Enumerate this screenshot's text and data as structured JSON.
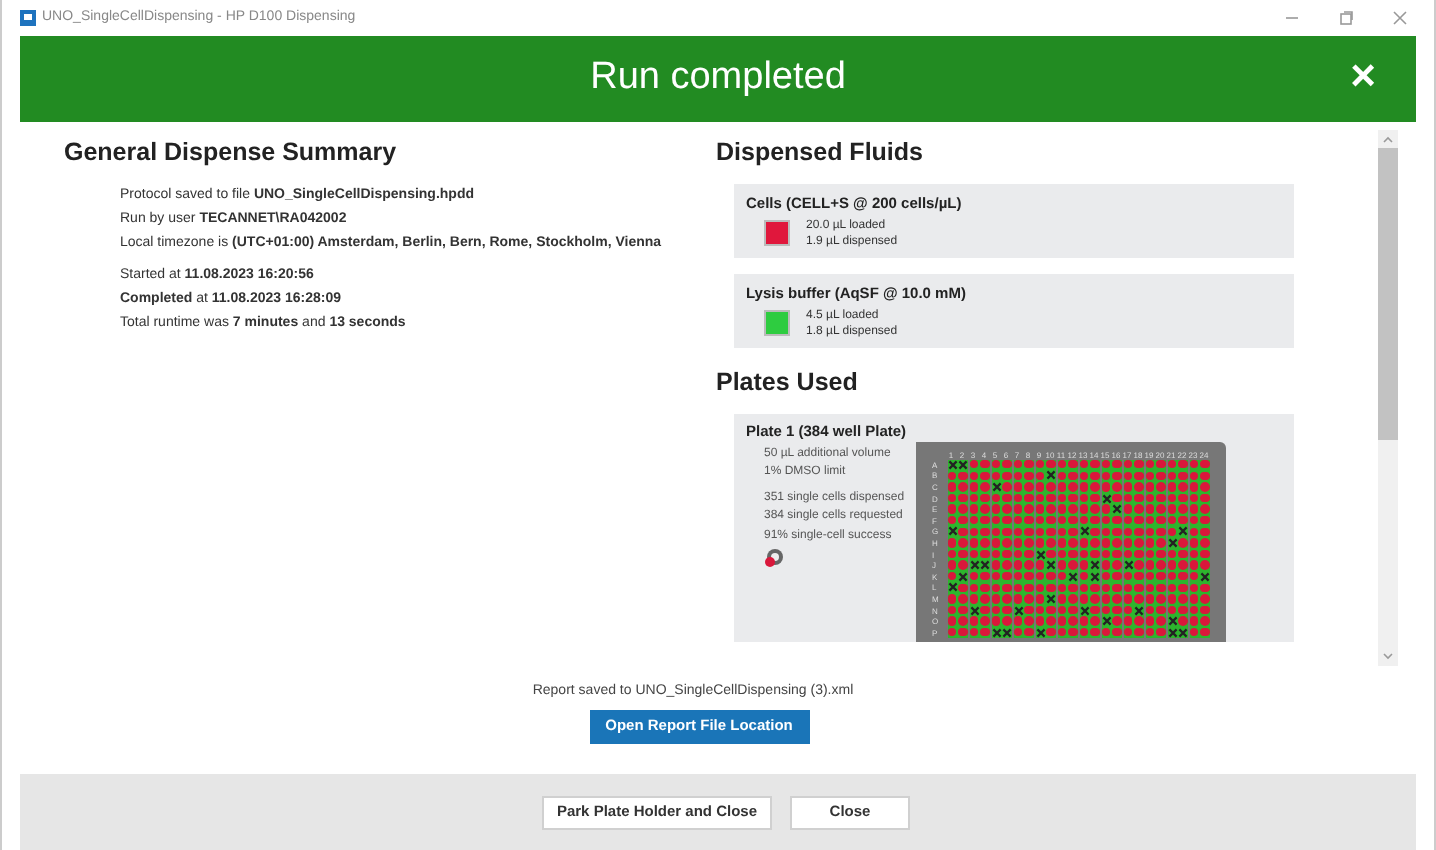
{
  "window": {
    "title": "UNO_SingleCellDispensing - HP D100 Dispensing"
  },
  "banner": {
    "title": "Run completed",
    "close": "×"
  },
  "summary": {
    "title": "General Dispense Summary",
    "lines": [
      "Protocol saved to file **UNO_SingleCellDispensing.hpdd**",
      "Run by user **TECANNET\\RA042002**",
      "Local timezone is **(UTC+01:00) Amsterdam, Berlin, Bern, Rome, Stockholm, Vienna**"
    ],
    "times": [
      "Started at **11.08.2023 16:20:56**",
      "**Completed** at **11.08.2023 16:28:09**",
      "Total runtime was **7 minutes** and **13 seconds**"
    ]
  },
  "fluids": {
    "title": "Dispensed Fluids",
    "items": [
      {
        "name": "Cells (CELL+S @ 200 cells/µL)",
        "color": "#e0173c",
        "loaded": "20.0 µL loaded",
        "dispensed": "1.9 µL dispensed"
      },
      {
        "name": "Lysis buffer (AqSF @ 10.0 mM)",
        "color": "#2ecc40",
        "loaded": "4.5 µL loaded",
        "dispensed": "1.8 µL dispensed"
      }
    ]
  },
  "plates": {
    "title": "Plates Used",
    "items": [
      {
        "name": "Plate 1 (384 well Plate)",
        "settings": [
          "50 µL additional volume",
          "1% DMSO limit"
        ],
        "stats": [
          "351 single cells dispensed",
          "384 single cells requested",
          "91% single-cell success"
        ],
        "columns": [
          "1",
          "2",
          "3",
          "4",
          "5",
          "6",
          "7",
          "8",
          "9",
          "10",
          "11",
          "12",
          "13",
          "14",
          "15",
          "16",
          "17",
          "18",
          "19",
          "20",
          "21",
          "22",
          "23",
          "24"
        ],
        "rows": [
          {
            "label": "A",
            "failed": [
              true,
              true,
              false,
              false,
              false,
              false,
              false,
              false,
              false,
              false,
              false,
              false,
              false,
              false,
              false,
              false,
              false,
              false,
              false,
              false,
              false,
              false,
              false,
              false
            ]
          },
          {
            "label": "B",
            "failed": [
              false,
              false,
              false,
              false,
              false,
              false,
              false,
              false,
              false,
              true,
              false,
              false,
              false,
              false,
              false,
              false,
              false,
              false,
              false,
              false,
              false,
              false,
              false,
              false
            ]
          },
          {
            "label": "C",
            "failed": [
              false,
              false,
              false,
              false,
              true,
              false,
              false,
              false,
              false,
              false,
              false,
              false,
              false,
              false,
              false,
              false,
              false,
              false,
              false,
              false,
              false,
              false,
              false,
              false
            ]
          },
          {
            "label": "D",
            "failed": [
              false,
              false,
              false,
              false,
              false,
              false,
              false,
              false,
              false,
              false,
              false,
              false,
              false,
              false,
              true,
              false,
              false,
              false,
              false,
              false,
              false,
              false,
              false,
              false
            ]
          },
          {
            "label": "E",
            "failed": [
              false,
              false,
              false,
              false,
              false,
              false,
              false,
              false,
              false,
              false,
              false,
              false,
              false,
              false,
              false,
              true,
              false,
              false,
              false,
              false,
              false,
              false,
              false,
              false
            ]
          },
          {
            "label": "F",
            "failed": [
              false,
              false,
              false,
              false,
              false,
              false,
              false,
              false,
              false,
              false,
              false,
              false,
              false,
              false,
              false,
              false,
              false,
              false,
              false,
              false,
              false,
              false,
              false,
              false
            ]
          },
          {
            "label": "G",
            "failed": [
              true,
              false,
              false,
              false,
              false,
              false,
              false,
              false,
              false,
              false,
              false,
              false,
              true,
              false,
              false,
              false,
              false,
              false,
              false,
              false,
              false,
              true,
              false,
              false
            ]
          },
          {
            "label": "H",
            "failed": [
              false,
              false,
              false,
              false,
              false,
              false,
              false,
              false,
              false,
              false,
              false,
              false,
              false,
              false,
              false,
              false,
              false,
              false,
              false,
              false,
              true,
              false,
              false,
              false
            ]
          },
          {
            "label": "I",
            "failed": [
              false,
              false,
              false,
              false,
              false,
              false,
              false,
              false,
              true,
              false,
              false,
              false,
              false,
              false,
              false,
              false,
              false,
              false,
              false,
              false,
              false,
              false,
              false,
              false
            ]
          },
          {
            "label": "J",
            "failed": [
              false,
              false,
              true,
              true,
              false,
              false,
              false,
              false,
              false,
              true,
              false,
              false,
              false,
              true,
              false,
              false,
              true,
              false,
              false,
              false,
              false,
              false,
              false,
              false
            ]
          },
          {
            "label": "K",
            "failed": [
              false,
              true,
              false,
              false,
              false,
              false,
              false,
              false,
              false,
              false,
              false,
              true,
              false,
              true,
              false,
              false,
              false,
              false,
              false,
              false,
              false,
              false,
              false,
              true
            ]
          },
          {
            "label": "L",
            "failed": [
              true,
              false,
              false,
              false,
              false,
              false,
              false,
              false,
              false,
              false,
              false,
              false,
              false,
              false,
              false,
              false,
              false,
              false,
              false,
              false,
              false,
              false,
              false,
              false
            ]
          },
          {
            "label": "M",
            "failed": [
              false,
              false,
              false,
              false,
              false,
              false,
              false,
              false,
              false,
              true,
              false,
              false,
              false,
              false,
              false,
              false,
              false,
              false,
              false,
              false,
              false,
              false,
              false,
              false
            ]
          },
          {
            "label": "N",
            "failed": [
              false,
              false,
              true,
              false,
              false,
              false,
              true,
              false,
              false,
              false,
              false,
              false,
              true,
              false,
              false,
              false,
              false,
              true,
              false,
              false,
              false,
              false,
              false,
              false
            ]
          },
          {
            "label": "O",
            "failed": [
              false,
              false,
              false,
              false,
              false,
              false,
              false,
              false,
              false,
              false,
              false,
              false,
              false,
              false,
              true,
              false,
              false,
              false,
              false,
              false,
              true,
              false,
              false,
              false
            ]
          },
          {
            "label": "P",
            "failed": [
              false,
              false,
              false,
              false,
              true,
              true,
              false,
              false,
              true,
              false,
              false,
              false,
              false,
              false,
              false,
              false,
              false,
              false,
              false,
              false,
              true,
              true,
              false,
              false
            ]
          }
        ]
      }
    ]
  },
  "report": {
    "text": "Report saved to UNO_SingleCellDispensing (3).xml",
    "button": "Open Report File Location"
  },
  "buttons": [
    "Park Plate Holder and Close",
    "Close"
  ]
}
